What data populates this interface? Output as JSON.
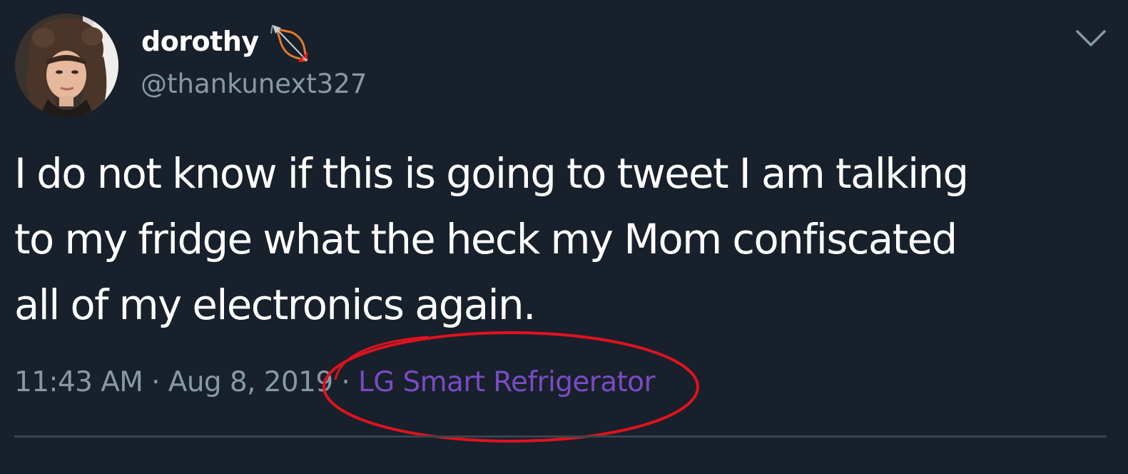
{
  "user": {
    "display_name": "dorothy",
    "handle": "@thankunext327"
  },
  "tweet": {
    "line1": "I do not know if this is going to tweet I am talking",
    "line2": "to my fridge what the heck my Mom confiscated",
    "line3": "all of my electronics again.",
    "time": "11:43 AM",
    "separator": " · ",
    "date": "Aug 8, 2019",
    "source": "LG Smart Refrigerator"
  },
  "icons": {
    "name_emoji": "bow-and-arrow-icon",
    "menu": "chevron-down-icon"
  },
  "colors": {
    "background": "#18202b",
    "text": "#ffffff",
    "secondary": "#8899a6",
    "source_link": "#794bc4",
    "annotation": "#e0121f",
    "divider": "#38444d"
  }
}
